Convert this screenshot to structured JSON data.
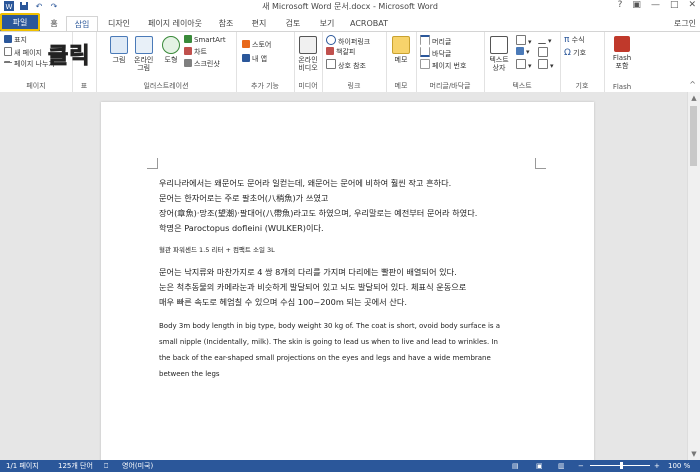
{
  "window": {
    "title": "새 Microsoft Word 문서.docx - Microsoft Word",
    "controls": [
      "?",
      "▣",
      "—",
      "□",
      "✕"
    ],
    "login": "로그인"
  },
  "qat": {
    "save_icon": "save-icon",
    "undo_icon": "↶",
    "redo_icon": "↷"
  },
  "tabs": [
    "파일",
    "홈",
    "삽입",
    "디자인",
    "페이지 레이아웃",
    "참조",
    "편지",
    "검토",
    "보기",
    "ACROBAT"
  ],
  "annotation": {
    "click_label": "클릭"
  },
  "ribbon": {
    "groups": [
      "페이지",
      "표",
      "일러스트레이션",
      "추가 기능",
      "미디어",
      "링크",
      "메모",
      "머리글/바닥글",
      "텍스트",
      "기호",
      "Flash"
    ],
    "page": [
      "표지",
      "새 페이지",
      "페이지 나누기"
    ],
    "illustration": [
      "그림",
      "온라인",
      "그림",
      "도형",
      "SmartArt",
      "차트",
      "스크린샷"
    ],
    "addins": [
      "스토어",
      "내 앱"
    ],
    "media": [
      "온라인",
      "비디오"
    ],
    "links": [
      "하이퍼링크",
      "책갈피",
      "상호 참조"
    ],
    "comment": "메모",
    "header": [
      "머리글",
      "바닥글",
      "페이지 번호"
    ],
    "text": [
      "텍스트",
      "상자"
    ],
    "symbols": [
      "수식",
      "기호"
    ],
    "flash": [
      "Flash",
      "포함"
    ]
  },
  "document": {
    "p1": [
      "우리나라에서는 왜문어도 문어라 일컫는데, 왜문어는 문어에 비하여 훨씬 작고 흔하다.",
      "문어는 한자어로는 주로 팔초어(八梢魚)가 쓰였고",
      "장어(章魚)·망조(望潮)·팔대어(八帶魚)라고도 하였으며, 우리말로는 예전부터 문어라 하였다.",
      "학명은 Paroctopus dofleini (WULKER)이다."
    ],
    "p2": "혈관 파워센드 1.5 리터 + 컴팩트 소일 3L",
    "p3": [
      "문어는 낙지류와 마찬가지로 4 쌍 8개의 다리를 가지며 다리에는 빨판이 배열되어 있다.",
      "눈은 척추동물의 카메라눈과 비슷하게 발달되어 있고 뇌도 발달되어 있다. 체표식 운동으로",
      "매우 빠른 속도로 헤엄칠 수 있으며 수심 100~200m 되는 곳에서 산다."
    ],
    "p4": [
      "Body 3m body length in big type, body weight 30 kg of. The coat is short, ovoid body surface is a",
      "small nipple (Incidentally, milk). The skin is going to lead us when to live and lead to wrinkles. In",
      "the back of the ear-shaped small projections on the eyes and legs and have a wide membrane",
      "between the legs"
    ]
  },
  "status": {
    "page": "1/1 페이지",
    "words": "125개 단어",
    "language": "영어(미국)",
    "zoom": "100 %"
  },
  "colors": {
    "accent": "#2b579a",
    "highlight": "#f0c000"
  }
}
